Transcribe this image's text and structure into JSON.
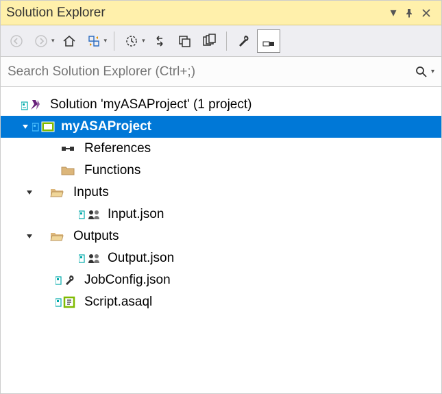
{
  "window": {
    "title": "Solution Explorer"
  },
  "search": {
    "placeholder": "Search Solution Explorer (Ctrl+;)"
  },
  "tree": {
    "solution_label": "Solution 'myASAProject' (1 project)",
    "project_label": "myASAProject",
    "references_label": "References",
    "functions_label": "Functions",
    "inputs_label": "Inputs",
    "input_file": "Input.json",
    "outputs_label": "Outputs",
    "output_file": "Output.json",
    "jobconfig_file": "JobConfig.json",
    "script_file": "Script.asaql"
  }
}
